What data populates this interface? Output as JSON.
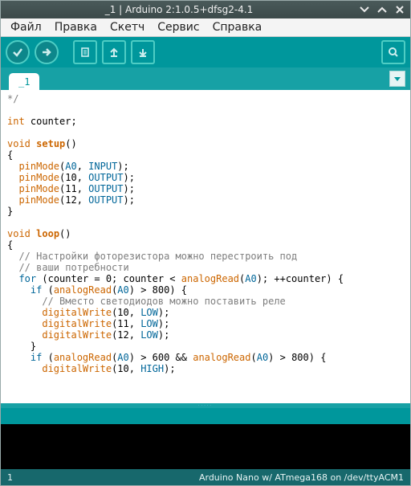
{
  "window": {
    "title": "_1 | Arduino 2:1.0.5+dfsg2-4.1"
  },
  "menus": {
    "file": "Файл",
    "edit": "Правка",
    "sketch": "Скетч",
    "tools": "Сервис",
    "help": "Справка"
  },
  "tabs": {
    "current": "_1"
  },
  "status": {
    "line": "1",
    "board": "Arduino Nano w/ ATmega168 on /dev/ttyACM1"
  },
  "chart_data": {
    "type": "table",
    "title": "Arduino sketch source",
    "language": "arduino",
    "lines": [
      "*/",
      "",
      "int counter;",
      "",
      "void setup()",
      "{",
      "  pinMode(A0, INPUT);",
      "  pinMode(10, OUTPUT);",
      "  pinMode(11, OUTPUT);",
      "  pinMode(12, OUTPUT);",
      "}",
      "",
      "void loop()",
      "{",
      "  // Настройки фоторезистора можно перестроить под",
      "  // ваши потребности",
      "  for (counter = 0; counter < analogRead(A0); ++counter) {",
      "    if (analogRead(A0) > 800) {",
      "      // Вместо светодиодов можно поставить реле",
      "      digitalWrite(10, LOW);",
      "      digitalWrite(11, LOW);",
      "      digitalWrite(12, LOW);",
      "    }",
      "    if (analogRead(A0) > 600 && analogRead(A0) > 800) {",
      "      digitalWrite(10, HIGH);"
    ]
  }
}
